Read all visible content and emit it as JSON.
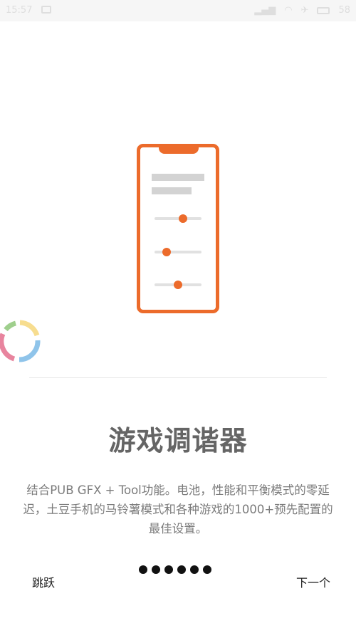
{
  "status_bar": {
    "time": "15:57",
    "icons": [
      "image-icon",
      "signal-icon",
      "wifi-icon",
      "airplane-icon",
      "battery-icon"
    ],
    "battery_level": "58"
  },
  "illustration": {
    "accent_color": "#ec6b2b",
    "slider_levels": [
      0.6,
      0.25,
      0.5
    ]
  },
  "title": "游戏调谐器",
  "description": "结合PUB GFX + Tool功能。电池，性能和平衡模式的零延迟，土豆手机的马铃薯模式和各种游戏的1000+预先配置的最佳设置。",
  "footer": {
    "skip_label": "跳跃",
    "next_label": "下一个",
    "page_count": 6
  }
}
